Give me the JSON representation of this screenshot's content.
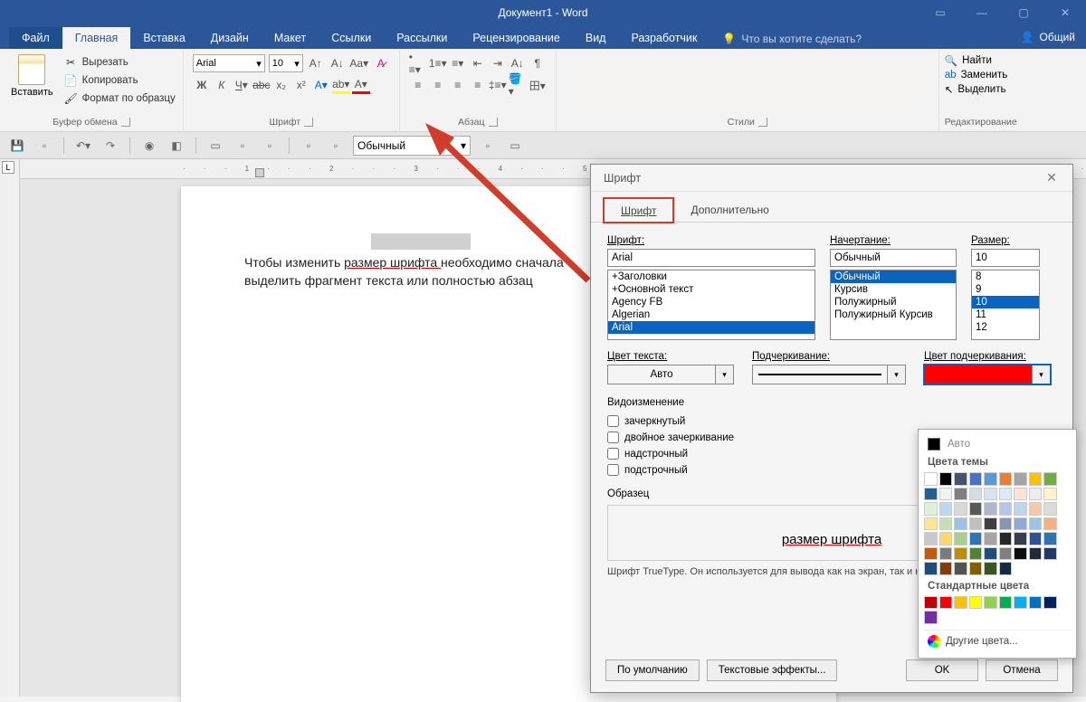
{
  "title": "Документ1 - Word",
  "tabs": {
    "file": "Файл",
    "home": "Главная",
    "insert": "Вставка",
    "design": "Дизайн",
    "layout": "Макет",
    "references": "Ссылки",
    "mailings": "Рассылки",
    "review": "Рецензирование",
    "view": "Вид",
    "developer": "Разработчик"
  },
  "tell_me": "Что вы хотите сделать?",
  "share": "Общий",
  "clipboard": {
    "paste": "Вставить",
    "cut": "Вырезать",
    "copy": "Копировать",
    "fmt": "Формат по образцу",
    "label": "Буфер обмена"
  },
  "font_group": {
    "label": "Шрифт",
    "name": "Arial",
    "size": "10"
  },
  "para_group": {
    "label": "Абзац"
  },
  "styles_group": {
    "label": "Стили"
  },
  "edit_group": {
    "label": "Редактирование",
    "find": "Найти",
    "replace": "Заменить",
    "select": "Выделить"
  },
  "qat": {
    "style": "Обычный"
  },
  "doc": {
    "line1_a": "Чтобы изменить ",
    "line1_b": "размер шрифта ",
    "line1_c": "необходимо сначала",
    "line2": "выделить фрагмент текста или полностью абзац"
  },
  "ruler": "· · · 1 · · · 2 · · · 3 · · · 4 · · · 5 · · · 6 · · · 7 · · · 8 · · · 9 · · · 10 · · · 11 · · · 12 · · · 13 · · · 14 · · · 15 · · ·",
  "dialog": {
    "title": "Шрифт",
    "tab_font": "Шрифт",
    "tab_adv": "Дополнительно",
    "font_lbl": "Шрифт:",
    "style_lbl": "Начертание:",
    "size_lbl": "Размер:",
    "font_val": "Arial",
    "style_val": "Обычный",
    "size_val": "10",
    "fonts": [
      "+Заголовки",
      "+Основной текст",
      "Agency FB",
      "Algerian",
      "Arial"
    ],
    "styles": [
      "Обычный",
      "Курсив",
      "Полужирный",
      "Полужирный Курсив"
    ],
    "sizes": [
      "8",
      "9",
      "10",
      "11",
      "12"
    ],
    "color_lbl": "Цвет текста:",
    "under_lbl": "Подчеркивание:",
    "ucolor_lbl": "Цвет подчеркивания:",
    "color_val": "Авто",
    "effects": "Видоизменение",
    "strike": "зачеркнутый",
    "dstrike": "двойное зачеркивание",
    "sup": "надстрочный",
    "sub": "подстрочный",
    "preview_lbl": "Образец",
    "preview_text": "размер шрифта",
    "hint": "Шрифт TrueType. Он используется для вывода как на экран, так и на принтер.",
    "btn_default": "По умолчанию",
    "btn_effects": "Текстовые эффекты...",
    "btn_ok": "OK",
    "btn_cancel": "Отмена"
  },
  "colorpop": {
    "auto": "Авто",
    "theme": "Цвета темы",
    "standard": "Стандартные цвета",
    "more": "Другие цвета...",
    "theme_colors": [
      "#ffffff",
      "#000000",
      "#44546a",
      "#4472c4",
      "#5b9bd5",
      "#ed7d31",
      "#a5a5a5",
      "#ffc000",
      "#70ad47",
      "#255e91",
      "#f2f2f2",
      "#7f7f7f",
      "#d6dce5",
      "#d9e2f3",
      "#deeaf6",
      "#fbe4d5",
      "#ededed",
      "#fff2cc",
      "#e2efda",
      "#bdd7ee",
      "#d9d9d9",
      "#595959",
      "#adb9ca",
      "#b4c6e7",
      "#bdd6ee",
      "#f7caac",
      "#dbdbdb",
      "#ffe599",
      "#c5e0b3",
      "#9bc2e6",
      "#bfbfbf",
      "#3f3f3f",
      "#8496b0",
      "#8eaadb",
      "#9cc2e5",
      "#f4b083",
      "#c9c9c9",
      "#ffd966",
      "#a8d08d",
      "#2e75b6",
      "#a5a5a5",
      "#262626",
      "#333f4f",
      "#2f5496",
      "#2e74b5",
      "#c45911",
      "#7b7b7b",
      "#bf8f00",
      "#538135",
      "#1f4e79",
      "#7f7f7f",
      "#0c0c0c",
      "#222a35",
      "#1f3864",
      "#1f4d78",
      "#833c0b",
      "#525252",
      "#806000",
      "#375623",
      "#132c44"
    ]
  }
}
